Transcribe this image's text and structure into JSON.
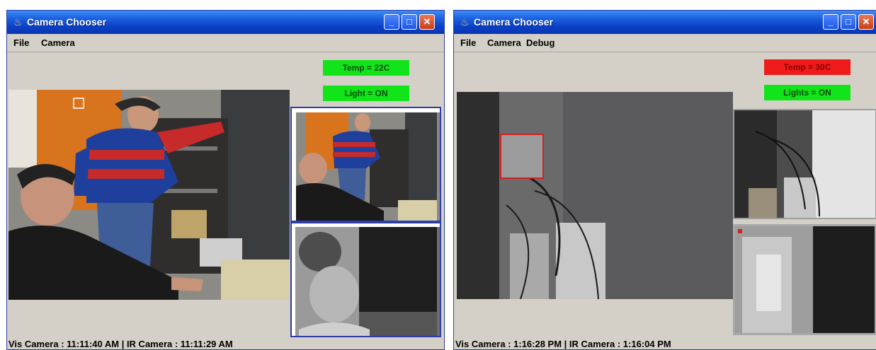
{
  "windows": [
    {
      "title": "Camera Chooser",
      "menu": [
        "File",
        "Camera"
      ],
      "badges": [
        {
          "label": "Temp = 22C",
          "color": "#11e51a"
        },
        {
          "label": "Light = ON",
          "color": "#11e51a"
        }
      ],
      "status_text": "Vis Camera : 11:11:40 AM | IR Camera : 11:11:29 AM"
    },
    {
      "title": "Camera Chooser",
      "menu": [
        "File",
        "Camera",
        "Debug"
      ],
      "badges": [
        {
          "label": "Temp = 30C",
          "color": "#ef1b1b"
        },
        {
          "label": "Lights = ON",
          "color": "#11e51a"
        }
      ],
      "status_text": "Vis Camera : 1:16:28 PM | IR Camera : 1:16:04 PM"
    }
  ],
  "icons": {
    "app": "java-coffee-icon",
    "minimize": "minimize-icon",
    "maximize": "maximize-icon",
    "close": "close-icon"
  }
}
